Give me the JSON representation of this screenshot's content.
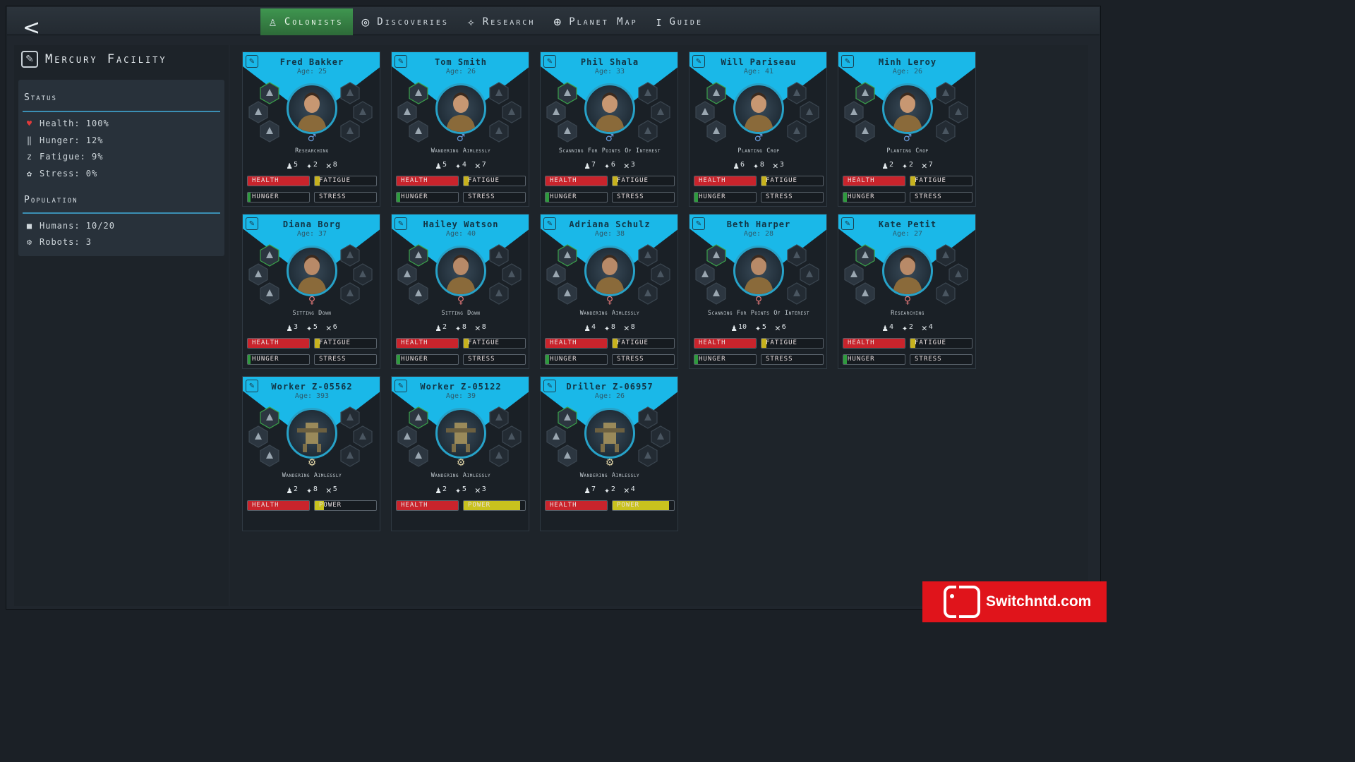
{
  "nav": {
    "back_symbol": "<",
    "tabs": [
      {
        "label": "Colonists",
        "icon": "colonist-icon",
        "active": true
      },
      {
        "label": "Discoveries",
        "icon": "globe-search-icon",
        "active": false
      },
      {
        "label": "Research",
        "icon": "research-molecule-icon",
        "active": false
      },
      {
        "label": "Planet Map",
        "icon": "globe-icon",
        "active": false
      },
      {
        "label": "Guide",
        "icon": "info-icon",
        "active": false
      }
    ]
  },
  "facility": {
    "name": "Mercury Facility"
  },
  "status": {
    "title": "Status",
    "items": [
      {
        "label": "Health: 100%",
        "icon": "heart-icon",
        "color": "#e03a3a"
      },
      {
        "label": "Hunger: 12%",
        "icon": "fork-knife-icon",
        "color": "#cfd7dc"
      },
      {
        "label": "Fatigue: 9%",
        "icon": "sleep-icon",
        "color": "#cfd7dc"
      },
      {
        "label": "Stress: 0%",
        "icon": "stress-icon",
        "color": "#cfd7dc"
      }
    ]
  },
  "population": {
    "title": "Population",
    "items": [
      {
        "label": "Humans: 10/20",
        "icon": "human-icon"
      },
      {
        "label": "Robots: 3",
        "icon": "gear-icon"
      }
    ]
  },
  "bar_labels": {
    "health": "Health",
    "fatigue": "Fatigue",
    "hunger": "Hunger",
    "stress": "Stress",
    "power": "Power"
  },
  "colors": {
    "accent": "#1ab8e8",
    "health": "#c9242c",
    "fatigue": "#c7b21e",
    "hunger": "#2f9a3e",
    "power": "#c9c21e"
  },
  "colonists": [
    {
      "name": "Fred Bakker",
      "age": "Age: 25",
      "gender": "male",
      "activity": "Researching",
      "stats": [
        "5",
        "2",
        "8"
      ],
      "type": "human",
      "health": 1.0,
      "fatigue": 0.08,
      "hunger": 0.05,
      "stress": 0
    },
    {
      "name": "Tom Smith",
      "age": "Age: 26",
      "gender": "male",
      "activity": "Wandering Aimlessly",
      "stats": [
        "5",
        "4",
        "7"
      ],
      "type": "human",
      "health": 1.0,
      "fatigue": 0.08,
      "hunger": 0.06,
      "stress": 0
    },
    {
      "name": "Phil Shala",
      "age": "Age: 33",
      "gender": "male",
      "activity": "Scanning For Points Of Interest",
      "stats": [
        "7",
        "6",
        "3"
      ],
      "type": "human",
      "health": 1.0,
      "fatigue": 0.08,
      "hunger": 0.06,
      "stress": 0
    },
    {
      "name": "Will Pariseau",
      "age": "Age: 41",
      "gender": "male",
      "activity": "Planting Crop",
      "stats": [
        "6",
        "8",
        "3"
      ],
      "type": "human",
      "health": 1.0,
      "fatigue": 0.08,
      "hunger": 0.06,
      "stress": 0
    },
    {
      "name": "Minh Leroy",
      "age": "Age: 26",
      "gender": "male",
      "activity": "Planting Crop",
      "stats": [
        "2",
        "2",
        "7"
      ],
      "type": "human",
      "health": 1.0,
      "fatigue": 0.08,
      "hunger": 0.06,
      "stress": 0
    },
    {
      "name": "Diana Borg",
      "age": "Age: 37",
      "gender": "female",
      "activity": "Sitting Down",
      "stats": [
        "3",
        "5",
        "6"
      ],
      "type": "human",
      "health": 1.0,
      "fatigue": 0.08,
      "hunger": 0.05,
      "stress": 0
    },
    {
      "name": "Hailey Watson",
      "age": "Age: 40",
      "gender": "female",
      "activity": "Sitting Down",
      "stats": [
        "2",
        "8",
        "8"
      ],
      "type": "human",
      "health": 1.0,
      "fatigue": 0.08,
      "hunger": 0.06,
      "stress": 0
    },
    {
      "name": "Adriana Schulz",
      "age": "Age: 38",
      "gender": "female",
      "activity": "Wandering Aimlessly",
      "stats": [
        "4",
        "8",
        "8"
      ],
      "type": "human",
      "health": 1.0,
      "fatigue": 0.08,
      "hunger": 0.06,
      "stress": 0
    },
    {
      "name": "Beth Harper",
      "age": "Age: 28",
      "gender": "female",
      "activity": "Scanning For Points Of Interest",
      "stats": [
        "10",
        "5",
        "6"
      ],
      "type": "human",
      "health": 1.0,
      "fatigue": 0.08,
      "hunger": 0.06,
      "stress": 0
    },
    {
      "name": "Kate Petit",
      "age": "Age: 27",
      "gender": "female",
      "activity": "Researching",
      "stats": [
        "4",
        "2",
        "4"
      ],
      "type": "human",
      "health": 1.0,
      "fatigue": 0.08,
      "hunger": 0.06,
      "stress": 0
    },
    {
      "name": "Worker Z-05562",
      "age": "Age: 393",
      "gender": "robot",
      "activity": "Wandering Aimlessly",
      "stats": [
        "2",
        "8",
        "5"
      ],
      "type": "robot",
      "health": 1.0,
      "power": 0.15
    },
    {
      "name": "Worker Z-05122",
      "age": "Age: 39",
      "gender": "robot",
      "activity": "Wandering Aimlessly",
      "stats": [
        "2",
        "5",
        "3"
      ],
      "type": "robot",
      "health": 1.0,
      "power": 0.92
    },
    {
      "name": "Driller Z-06957",
      "age": "Age: 26",
      "gender": "robot",
      "activity": "Wandering Aimlessly",
      "stats": [
        "7",
        "2",
        "4"
      ],
      "type": "robot",
      "health": 1.0,
      "power": 0.92
    }
  ],
  "watermark": {
    "text": "Switchntd.com"
  }
}
